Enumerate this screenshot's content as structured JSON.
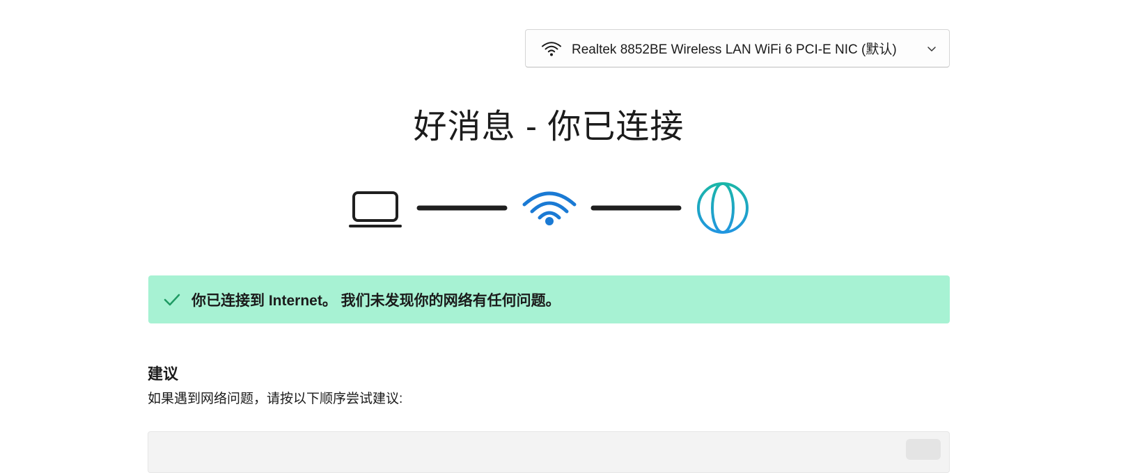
{
  "adapter": {
    "icon": "wifi-icon",
    "label": "Realtek 8852BE Wireless LAN WiFi 6 PCI-E NIC (默认)",
    "chevron_icon": "chevron-down-icon"
  },
  "headline": "好消息 - 你已连接",
  "diagram": {
    "nodes": [
      "laptop-icon",
      "wifi-icon",
      "globe-icon"
    ],
    "colors": {
      "line": "#1f1f1f",
      "wifi": "#1a7ad4",
      "globe_top": "#1bb6a8",
      "globe_bottom": "#2196e0"
    }
  },
  "status": {
    "icon": "check-icon",
    "text": "你已连接到 Internet。 我们未发现你的网络有任何问题。",
    "background": "#a7f2d3",
    "check_color": "#1f9a63"
  },
  "suggestions": {
    "title": "建议",
    "description": "如果遇到网络问题，请按以下顺序尝试建议:"
  }
}
